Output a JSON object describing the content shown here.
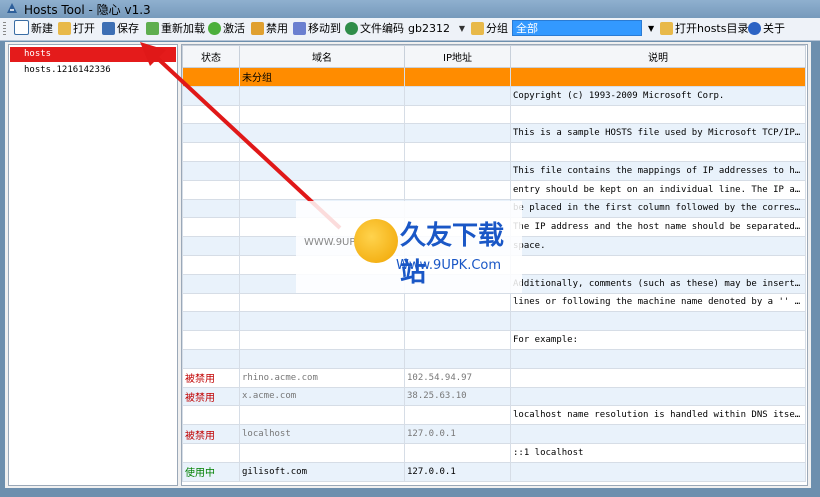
{
  "window": {
    "title": "Hosts Tool - 隐心 v1.3"
  },
  "toolbar": {
    "new": "新建",
    "open": "打开",
    "save": "保存",
    "reload": "重新加载",
    "activate": "激活",
    "disable": "禁用",
    "move_to": "移动到",
    "file_encoding": "文件编码",
    "encoding_value": "gb2312",
    "group": "分组",
    "group_value": "全部",
    "open_hosts_dir": "打开hosts目录",
    "about": "关于"
  },
  "sidebar": {
    "items": [
      {
        "label": "hosts",
        "selected": true
      },
      {
        "label": "hosts.1216142336",
        "selected": false
      }
    ]
  },
  "table": {
    "headers": [
      "状态",
      "域名",
      "IP地址",
      "说明"
    ],
    "rows": [
      {
        "type": "group",
        "status": "",
        "domain": "未分组",
        "ip": "",
        "note": ""
      },
      {
        "status": "",
        "domain": "",
        "ip": "",
        "note": "Copyright (c) 1993-2009 Microsoft Corp."
      },
      {
        "status": "",
        "domain": "",
        "ip": "",
        "note": ""
      },
      {
        "status": "",
        "domain": "",
        "ip": "",
        "note": "This is a sample HOSTS file used by Microsoft TCP/IP for..."
      },
      {
        "status": "",
        "domain": "",
        "ip": "",
        "note": ""
      },
      {
        "status": "",
        "domain": "",
        "ip": "",
        "note": "This file contains the mappings of IP addresses to host ..."
      },
      {
        "status": "",
        "domain": "",
        "ip": "",
        "note": "entry should be kept on an individual line. The IP addre..."
      },
      {
        "status": "",
        "domain": "",
        "ip": "",
        "note": "be placed in the first column followed by the correspond..."
      },
      {
        "status": "",
        "domain": "",
        "ip": "",
        "note": "The IP address and the host name should be separated by ..."
      },
      {
        "status": "",
        "domain": "",
        "ip": "",
        "note": "space."
      },
      {
        "status": "",
        "domain": "",
        "ip": "",
        "note": ""
      },
      {
        "status": "",
        "domain": "",
        "ip": "",
        "note": "Additionally, comments (such as these) may be inserted o..."
      },
      {
        "status": "",
        "domain": "",
        "ip": "",
        "note": "lines or following the machine name denoted by a '' symbol."
      },
      {
        "status": "",
        "domain": "",
        "ip": "",
        "note": ""
      },
      {
        "status": "",
        "domain": "",
        "ip": "",
        "note": "For example:"
      },
      {
        "status": "",
        "domain": "",
        "ip": "",
        "note": ""
      },
      {
        "status": "被禁用",
        "state": "disabled",
        "domain": "rhino.acme.com",
        "ip": "102.54.94.97",
        "note": ""
      },
      {
        "status": "被禁用",
        "state": "disabled",
        "domain": "x.acme.com",
        "ip": "38.25.63.10",
        "note": ""
      },
      {
        "status": "",
        "domain": "",
        "ip": "",
        "note": "localhost name resolution is handled within DNS itself."
      },
      {
        "status": "被禁用",
        "state": "disabled",
        "domain": "localhost",
        "ip": "127.0.0.1",
        "note": ""
      },
      {
        "status": "",
        "domain": "",
        "ip": "",
        "note": "::1 localhost"
      },
      {
        "status": "使用中",
        "state": "active",
        "domain": "gilisoft.com",
        "ip": "127.0.0.1",
        "note": ""
      }
    ]
  },
  "watermark": {
    "left_text": "WWW.9UPK.COM",
    "main": "久友下载站",
    "url": "Www.9UPK.Com"
  },
  "colors": {
    "group_row": "#ff8c00",
    "selected_item": "#e41b1b",
    "disabled_text": "#c00000",
    "active_text": "#008000",
    "alt_row": "#e9f2fb"
  }
}
